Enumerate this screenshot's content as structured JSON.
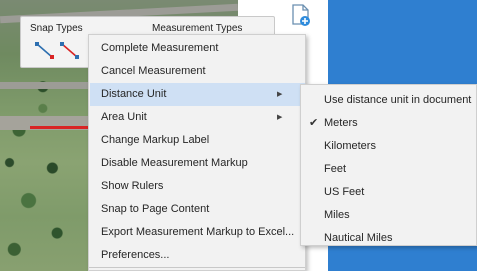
{
  "toolbar": {
    "snap_types_label": "Snap Types",
    "measurement_types_label": "Measurement Types",
    "snap_icons": [
      "snap-line-icon",
      "snap-point-icon"
    ]
  },
  "context_menu": {
    "items": [
      {
        "label": "Complete Measurement",
        "has_submenu": false
      },
      {
        "label": "Cancel Measurement",
        "has_submenu": false
      },
      {
        "label": "Distance Unit",
        "has_submenu": true,
        "highlighted": true
      },
      {
        "label": "Area Unit",
        "has_submenu": true
      },
      {
        "label": "Change Markup Label",
        "has_submenu": false
      },
      {
        "label": "Disable Measurement Markup",
        "has_submenu": false
      },
      {
        "label": "Show Rulers",
        "has_submenu": false
      },
      {
        "label": "Snap to Page Content",
        "has_submenu": false
      },
      {
        "label": "Export Measurement Markup to Excel...",
        "has_submenu": false
      },
      {
        "label": "Preferences...",
        "has_submenu": false
      }
    ]
  },
  "distance_unit_submenu": {
    "items": [
      {
        "label": "Use distance unit in document",
        "checked": false
      },
      {
        "label": "Meters",
        "checked": true
      },
      {
        "label": "Kilometers",
        "checked": false
      },
      {
        "label": "Feet",
        "checked": false
      },
      {
        "label": "US Feet",
        "checked": false
      },
      {
        "label": "Miles",
        "checked": false
      },
      {
        "label": "Nautical Miles",
        "checked": false
      }
    ]
  },
  "colors": {
    "menu_highlight": "#cfe0f4",
    "measure_line": "#d92424",
    "background_blue": "#2f7fd0"
  }
}
